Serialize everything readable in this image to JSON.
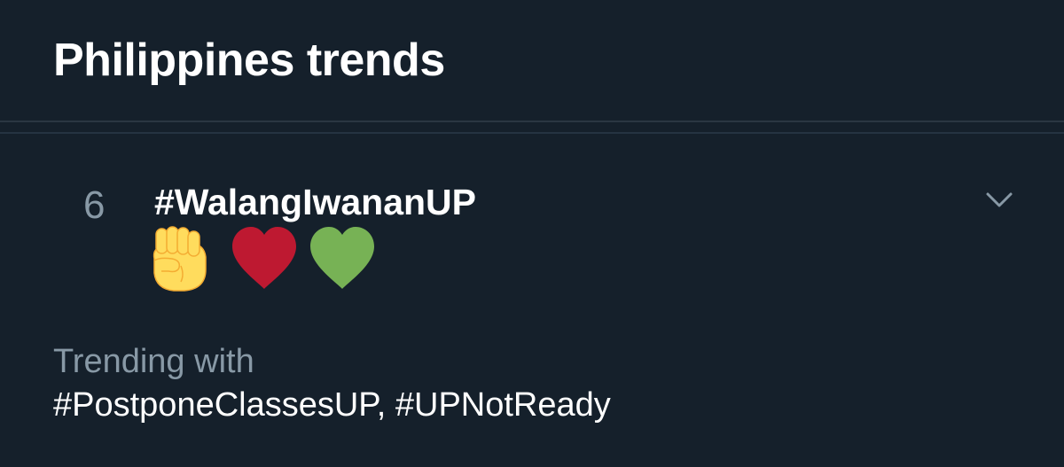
{
  "header": {
    "title": "Philippines trends"
  },
  "trend": {
    "rank": "6",
    "hashtag": "#WalangIwananUP",
    "emojis": [
      "raised-fist",
      "red-heart",
      "green-heart"
    ],
    "trending_with_label": "Trending with",
    "trending_with_tags": "#PostponeClassesUP, #UPNotReady",
    "menu_icon": "chevron-down-icon"
  },
  "colors": {
    "background": "#15202b",
    "divider": "#2a3642",
    "secondary_text": "#8899a6",
    "primary_text": "#ffffff",
    "fist": "#ffdc5d",
    "red_heart": "#be1931",
    "green_heart": "#77b255"
  }
}
